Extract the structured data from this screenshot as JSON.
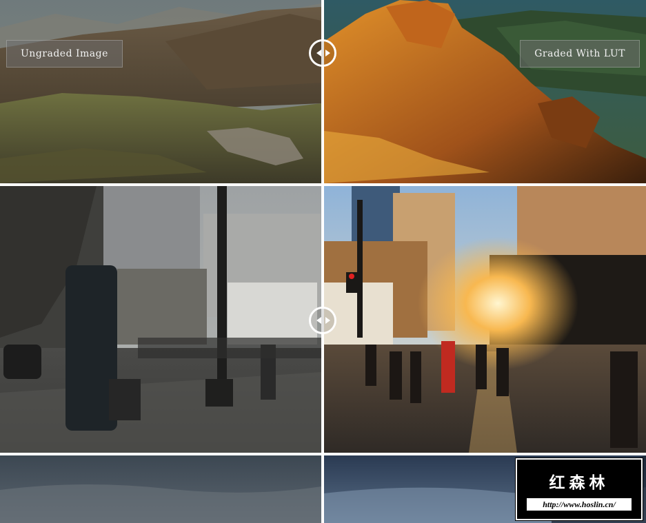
{
  "comparison": {
    "left_label": "Ungraded Image",
    "right_label": "Graded With LUT"
  },
  "rows": [
    {
      "subject": "mountain landscape"
    },
    {
      "subject": "city street at sunset"
    },
    {
      "subject": "cloudy sky"
    }
  ],
  "watermark": {
    "title": "红森林",
    "url": "http://www.hoslin.cn/"
  },
  "icons": {
    "slider_handle": "left-right-arrows-icon"
  },
  "colors": {
    "divider": "#ffffff",
    "label_bg": "#6e6e6e",
    "graded_warm": "#c9780f",
    "ungraded_muted": "#6f6a52"
  }
}
